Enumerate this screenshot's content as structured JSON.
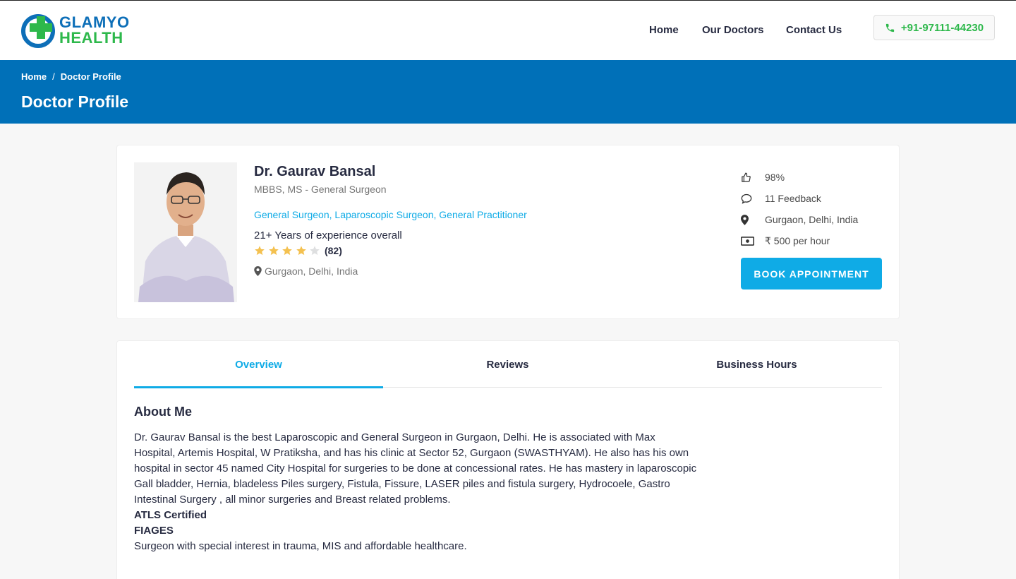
{
  "brand": {
    "line1": "GLAMYO",
    "line2": "HEALTH",
    "primary_color": "#0d6fb8",
    "accent_color": "#2db84b"
  },
  "nav": {
    "items": [
      "Home",
      "Our Doctors",
      "Contact Us"
    ],
    "phone": "+91-97111-44230",
    "phone_icon": "phone-icon"
  },
  "breadcrumb": {
    "home": "Home",
    "separator": "/",
    "current": "Doctor Profile"
  },
  "page_title": "Doctor Profile",
  "doctor": {
    "name": "Dr. Gaurav Bansal",
    "degree": "MBBS, MS - General Surgeon",
    "specialities": "General Surgeon, Laparoscopic Surgeon, General Practitioner",
    "experience": "21+ Years of experience overall",
    "rating": 4,
    "rating_max": 5,
    "rating_count": "(82)",
    "location": "Gurgaon, Delhi, India"
  },
  "stats": {
    "likes": "98%",
    "feedback": "11 Feedback",
    "location": "Gurgaon, Delhi, India",
    "fee": "₹ 500 per hour"
  },
  "book_button": "BOOK APPOINTMENT",
  "tabs": [
    "Overview",
    "Reviews",
    "Business Hours"
  ],
  "active_tab": "Overview",
  "about": {
    "title": "About Me",
    "paragraph": "Dr. Gaurav Bansal is the best Laparoscopic and General Surgeon in Gurgaon, Delhi. He is associated with Max Hospital, Artemis Hospital, W Pratiksha, and has his clinic at Sector 52, Gurgaon (SWASTHYAM). He also has his own hospital in sector 45 named City Hospital for surgeries to be done at concessional rates. He has mastery in laparoscopic Gall bladder, Hernia, bladeless Piles surgery, Fistula, Fissure, LASER piles and fistula surgery, Hydrocoele, Gastro Intestinal Surgery , all minor surgeries and Breast related problems.",
    "cert1": "ATLS Certified",
    "cert2": "FIAGES",
    "closing": "Surgeon with special interest in trauma, MIS and affordable healthcare."
  },
  "colors": {
    "header_blue": "#0070b8",
    "accent_cyan": "#0fabe6",
    "star_filled": "#f4c150",
    "star_empty": "#dedfe0"
  }
}
